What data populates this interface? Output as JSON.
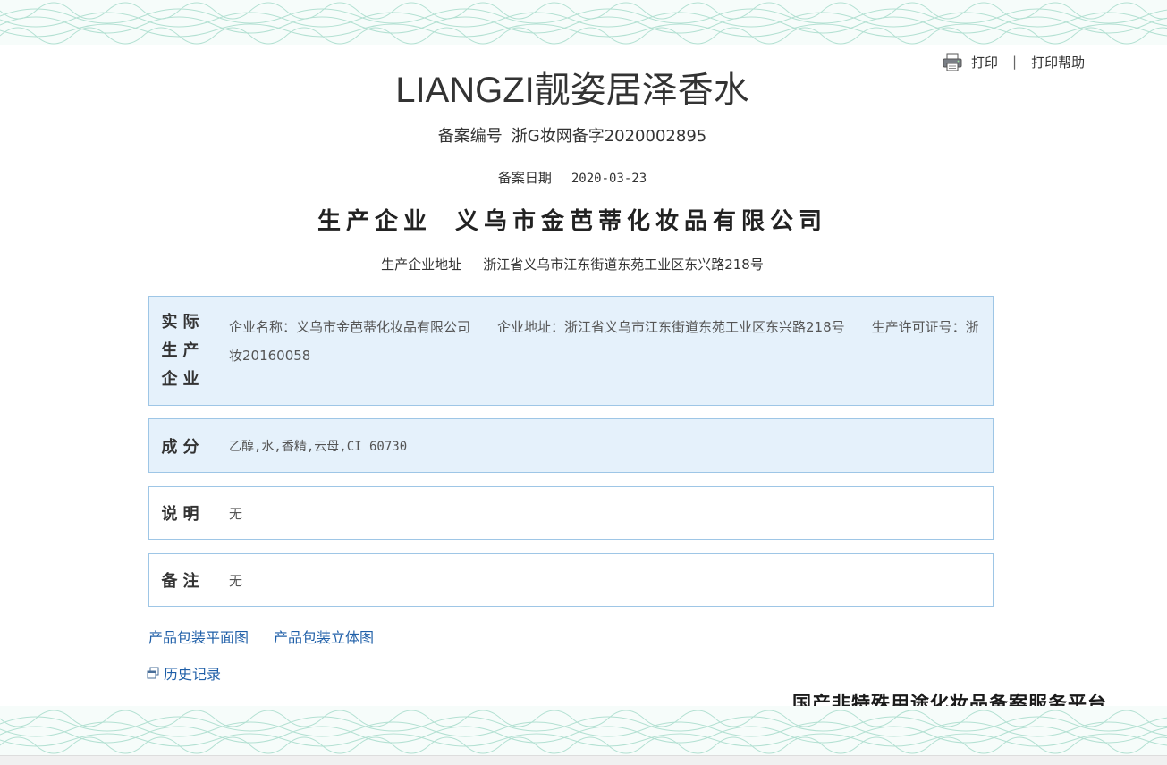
{
  "print_bar": {
    "print": "打印",
    "separator": "|",
    "help": "打印帮助"
  },
  "product": {
    "name": "LIANGZI靓姿居泽香水",
    "reg_no_label": "备案编号",
    "reg_no": "浙G妆网备字2020002895",
    "reg_date_label": "备案日期",
    "reg_date": "2020-03-23",
    "producer_label": "生产企业",
    "producer": "义乌市金芭蒂化妆品有限公司",
    "address_label": "生产企业地址",
    "address": "浙江省义乌市江东街道东苑工业区东兴路218号"
  },
  "sections": {
    "actual_producer": {
      "label_lines": [
        "实际",
        "生产",
        "企业"
      ],
      "company_name": "企业名称：义乌市金芭蒂化妆品有限公司",
      "company_address": "企业地址：浙江省义乌市江东街道东苑工业区东兴路218号",
      "license": "生产许可证号：浙妆20160058"
    },
    "ingredients": {
      "label": "成分",
      "value": "乙醇,水,香精,云母,CI 60730"
    },
    "description": {
      "label": "说明",
      "value": "无"
    },
    "remarks": {
      "label": "备注",
      "value": "无"
    }
  },
  "links": {
    "flat_image": "产品包装平面图",
    "3d_image": "产品包装立体图",
    "history": "历史记录"
  },
  "footer": {
    "platform": "国产非特殊用途化妆品备案服务平台"
  },
  "icons": {
    "print": "printer-icon",
    "history": "window-restore-icon"
  }
}
